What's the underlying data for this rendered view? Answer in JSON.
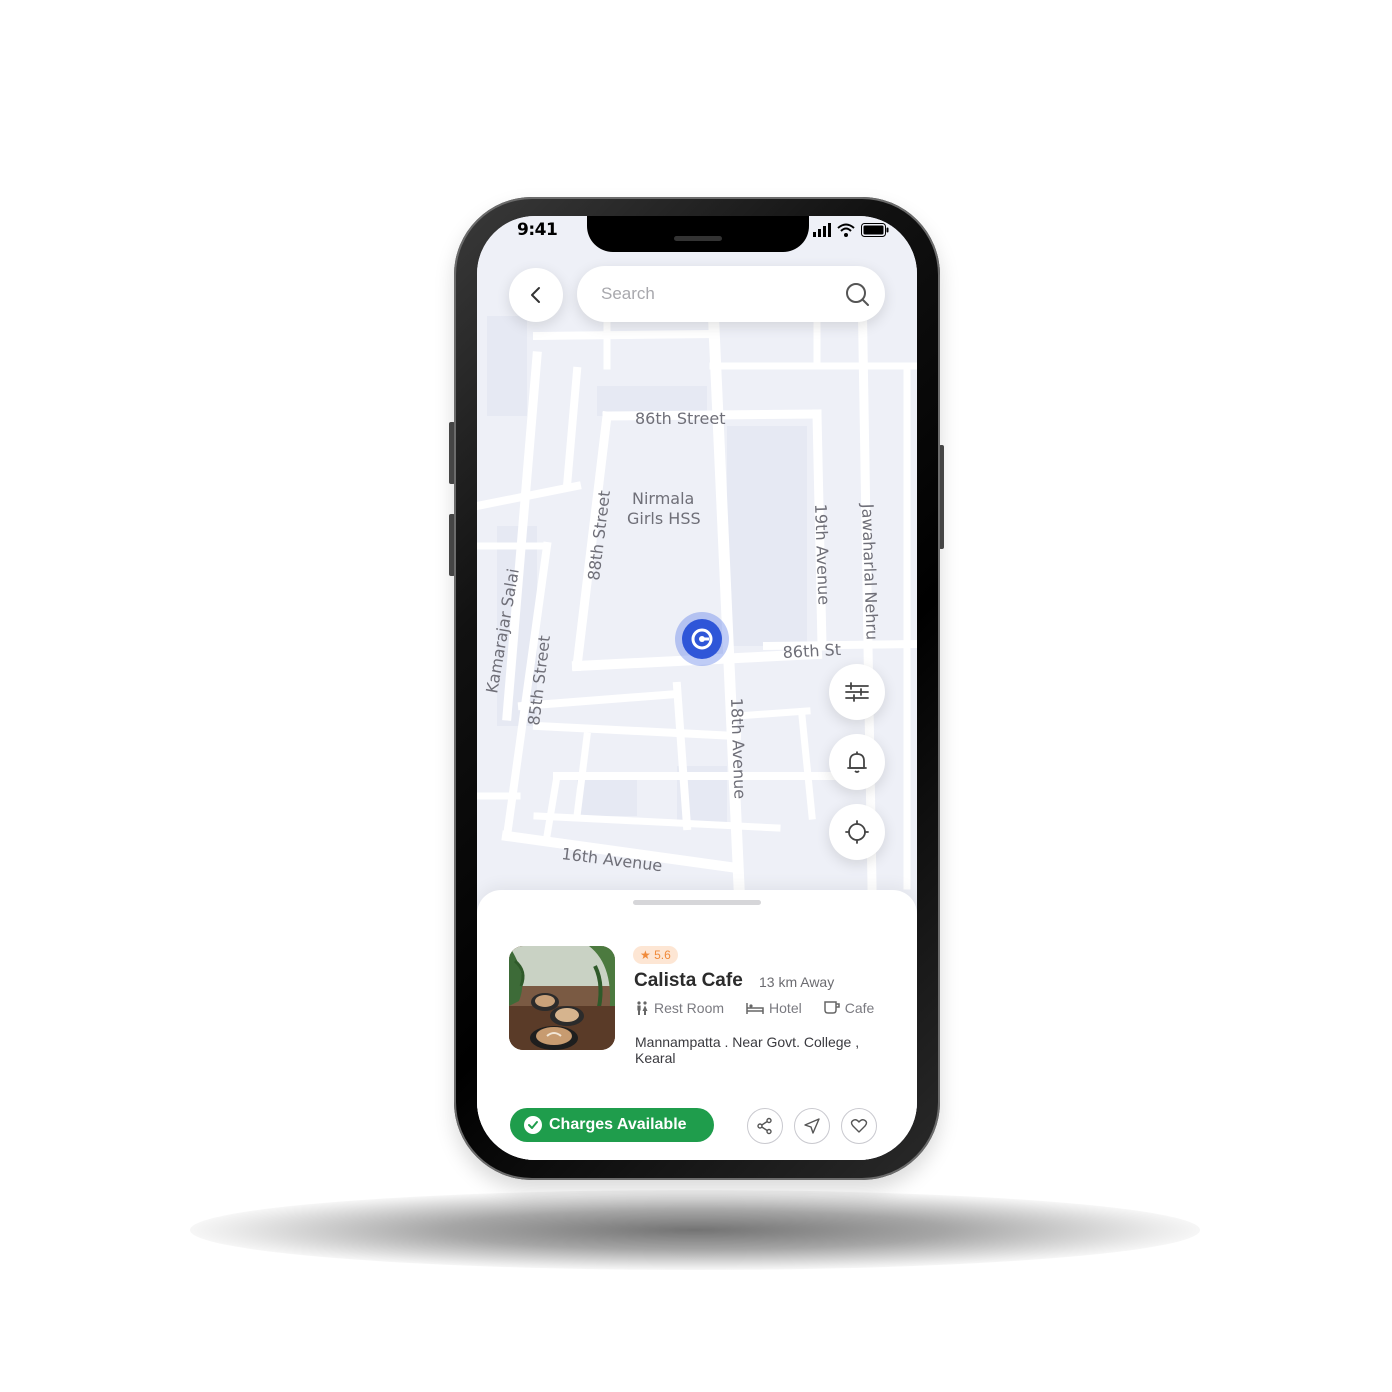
{
  "status_bar": {
    "time": "9:41"
  },
  "search": {
    "placeholder": "Search"
  },
  "map": {
    "street_labels": {
      "street_86_top": "86th Street",
      "school": "Nirmala\nGirls HSS",
      "street_88": "88th Street",
      "avenue_19": "19th Avenue",
      "jawaharlal": "Jawaharlal Nehru",
      "kamarajar": "Kamarajar Salai",
      "street_85": "85th Street",
      "street_86_st": "86th St",
      "avenue_18": "18th Avenue",
      "avenue_16": "16th Avenue"
    }
  },
  "place": {
    "rating": "★ 5.6",
    "name": "Calista Cafe",
    "distance": "13 km Away",
    "amenities": {
      "restroom": "Rest Room",
      "hotel": "Hotel",
      "cafe": "Cafe"
    },
    "address": "Mannampatta . Near Govt. College , Kearal",
    "charges_label": "Charges Available"
  },
  "colors": {
    "accent_green": "#1f9d4c",
    "pin_blue": "#2f56d8",
    "rating_bg": "#fde6d4",
    "rating_text": "#f08a3a",
    "map_bg": "#eef0f7"
  },
  "icons": [
    "back-arrow-icon",
    "search-icon",
    "filter-icon",
    "bell-icon",
    "locate-icon",
    "location-pin-icon",
    "restroom-icon",
    "hotel-icon",
    "cafe-icon",
    "check-icon",
    "share-icon",
    "navigate-icon",
    "heart-icon"
  ]
}
